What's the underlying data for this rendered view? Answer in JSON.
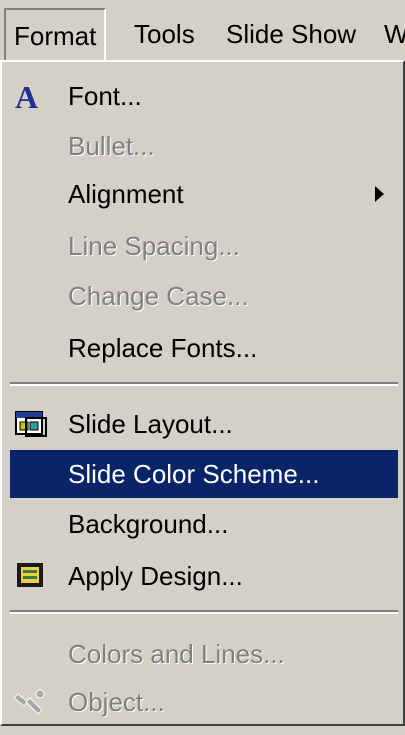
{
  "menubar": {
    "items": [
      {
        "label": "Format"
      },
      {
        "label": "Tools"
      },
      {
        "label": "Slide Show"
      },
      {
        "label": "W"
      }
    ]
  },
  "menu": {
    "items": [
      {
        "label": "Font...",
        "icon": "font-a-icon",
        "enabled": true
      },
      {
        "label": "Bullet...",
        "enabled": false
      },
      {
        "label": "Alignment",
        "enabled": true,
        "submenu": true
      },
      {
        "label": "Line Spacing...",
        "enabled": false
      },
      {
        "label": "Change Case...",
        "enabled": false
      },
      {
        "label": "Replace Fonts...",
        "enabled": true
      },
      {
        "label": "Slide Layout...",
        "icon": "slide-layout-icon",
        "enabled": true
      },
      {
        "label": "Slide Color Scheme...",
        "enabled": true,
        "selected": true
      },
      {
        "label": "Background...",
        "enabled": true
      },
      {
        "label": "Apply Design...",
        "icon": "apply-design-icon",
        "enabled": true
      },
      {
        "label": "Colors and Lines...",
        "enabled": false
      },
      {
        "label": "Object...",
        "icon": "object-icon",
        "enabled": false
      }
    ]
  },
  "colors": {
    "menu_bg": "#d4d0c8",
    "highlight": "#0a246a",
    "disabled_text": "#808080",
    "font_icon": "#1f2f8f"
  }
}
